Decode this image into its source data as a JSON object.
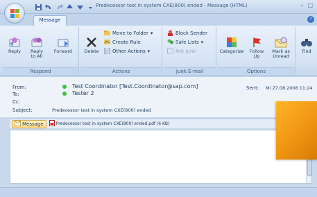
{
  "window": {
    "title": "Predecessor test in system CXE(800) ended - Message (HTML)",
    "controls": [
      "–",
      "□",
      "×"
    ]
  },
  "ribbon": {
    "tab": "Message",
    "groups": {
      "respond": {
        "label": "Respond",
        "reply": "Reply",
        "reply_all": "Reply to All",
        "forward": "Forward"
      },
      "actions": {
        "label": "Actions",
        "delete": "Delete",
        "move_to_folder": "Move to Folder",
        "create_rule": "Create Rule",
        "other_actions": "Other Actions"
      },
      "junk": {
        "label": "Junk E-mail",
        "block_sender": "Block Sender",
        "safe_lists": "Safe Lists",
        "not_junk": "Not Junk"
      },
      "options": {
        "label": "Options",
        "categorize": "Categorize",
        "follow_up": "Follow Up",
        "mark_as_unread": "Mark as Unread"
      },
      "find": {
        "find": "Find"
      }
    }
  },
  "header": {
    "from_label": "From:",
    "from_value": "Test Coordinator [Test.Coordinator@sap.com]",
    "to_label": "To:",
    "to_value": "Tester 2",
    "cc_label": "Cc:",
    "subject_label": "Subject:",
    "subject_value": "Predecessor test in system CXE(800) ended",
    "sent_label": "Sent:",
    "sent_value": "Mi 27.08.2008 11:24"
  },
  "attachments": {
    "message_tab": "Message",
    "file": "Predecessor test in system CXE(800) ended.pdf (6 KB)"
  },
  "colors": {
    "accent": "#15428b",
    "presence": "#3fbf3a",
    "highlight": "#f09512"
  }
}
